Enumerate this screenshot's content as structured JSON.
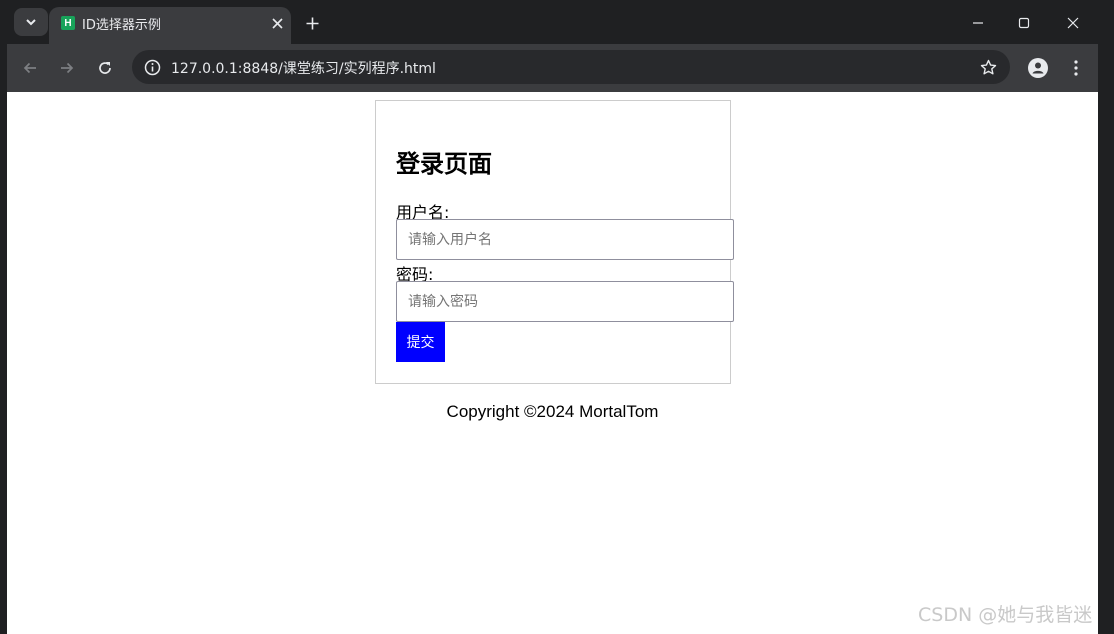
{
  "browser": {
    "tab": {
      "title": "ID选择器示例",
      "favicon_letter": "H"
    },
    "url": "127.0.0.1:8848/课堂练习/实列程序.html"
  },
  "page": {
    "heading": "登录页面",
    "username": {
      "label": "用户名:",
      "placeholder": "请输入用户名",
      "value": ""
    },
    "password": {
      "label": "密码:",
      "placeholder": "请输入密码",
      "value": ""
    },
    "submit_label": "提交",
    "copyright": "Copyright ©2024 MortalTom"
  },
  "watermark": "CSDN @她与我皆迷",
  "colors": {
    "submit_bg": "#0000ff",
    "tab_bg": "#3b3c3f",
    "frame_bg": "#1f2022",
    "favicon": "#18a35a"
  },
  "icons": [
    "tab-search-icon",
    "close-icon",
    "plus-icon",
    "minimize-icon",
    "maximize-icon",
    "window-close-icon",
    "back-arrow-icon",
    "forward-arrow-icon",
    "reload-icon",
    "info-icon",
    "star-icon",
    "profile-icon",
    "kebab-menu-icon"
  ]
}
